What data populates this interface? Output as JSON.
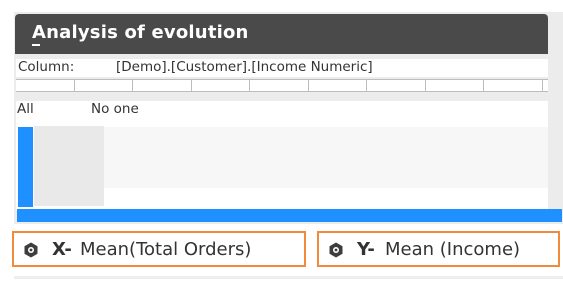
{
  "panel": {
    "title": "Analysis of evolution",
    "column_label": "Column:",
    "column_value": "[Demo].[Customer].[Income Numeric]",
    "filter_all": "All",
    "filter_none": "No one"
  },
  "metrics": [
    {
      "axis": "X-",
      "description": "Mean(Total Orders)",
      "icon": "hexagon-gear-icon"
    },
    {
      "axis": "Y-",
      "description": "Mean (Income)",
      "icon": "hexagon-gear-icon"
    }
  ],
  "colors": {
    "title_bar": "#4a4a4a",
    "accent_blue": "#1e90ff",
    "metric_border": "#f08a3c"
  }
}
